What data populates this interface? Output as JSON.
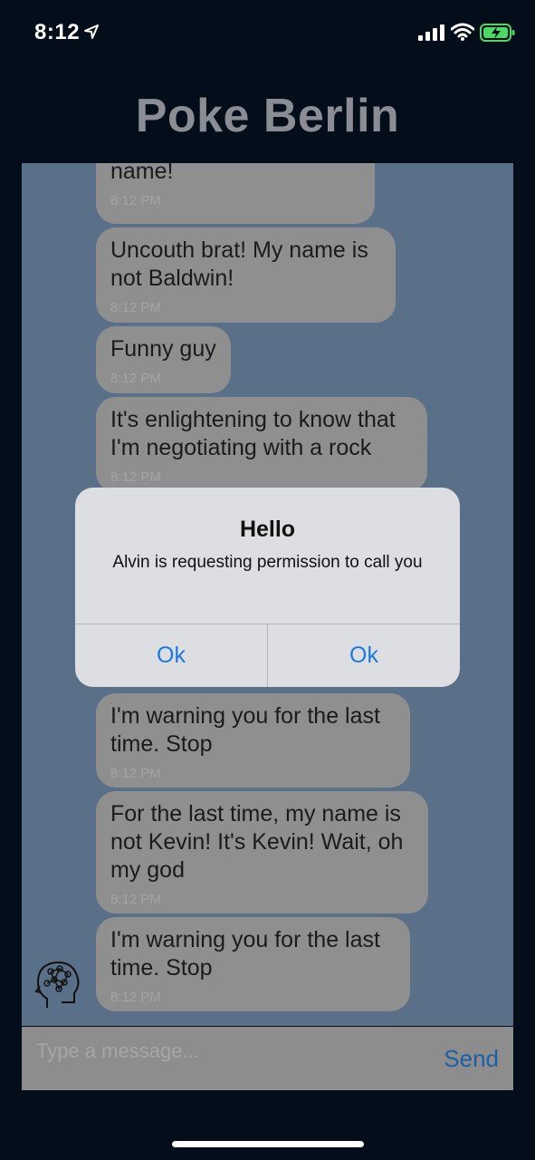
{
  "status_bar": {
    "time": "8:12",
    "icons": [
      "location-arrow-icon",
      "cellular-signal-icon",
      "wifi-icon",
      "battery-charging-icon"
    ]
  },
  "app": {
    "title": "Poke Berlin"
  },
  "messages": [
    {
      "text": "name!",
      "time": "8:12 PM"
    },
    {
      "text": "Uncouth brat! My name is not Baldwin!",
      "time": "8:12 PM"
    },
    {
      "text": "Funny guy",
      "time": "8:12 PM"
    },
    {
      "text": "It's enlightening to know that I'm negotiating with a rock",
      "time": "8:12 PM"
    },
    {
      "text": "I'm warning you for the last time. Stop",
      "time": "8:12 PM"
    },
    {
      "text": "For the last time, my name is not Kevin! It's Kevin! Wait, oh my god",
      "time": "8:12 PM"
    },
    {
      "text": "I'm warning you for the last time. Stop",
      "time": "8:12 PM"
    }
  ],
  "composer": {
    "placeholder": "Type a message...",
    "send_label": "Send"
  },
  "alert": {
    "title": "Hello",
    "message": "Alvin is requesting permission to call you",
    "buttons": [
      "Ok",
      "Ok"
    ]
  },
  "colors": {
    "background": "#040d1a",
    "chat_background": "#5a7089",
    "bubble": "#8f8f8f",
    "accent": "#1a7ae0"
  }
}
